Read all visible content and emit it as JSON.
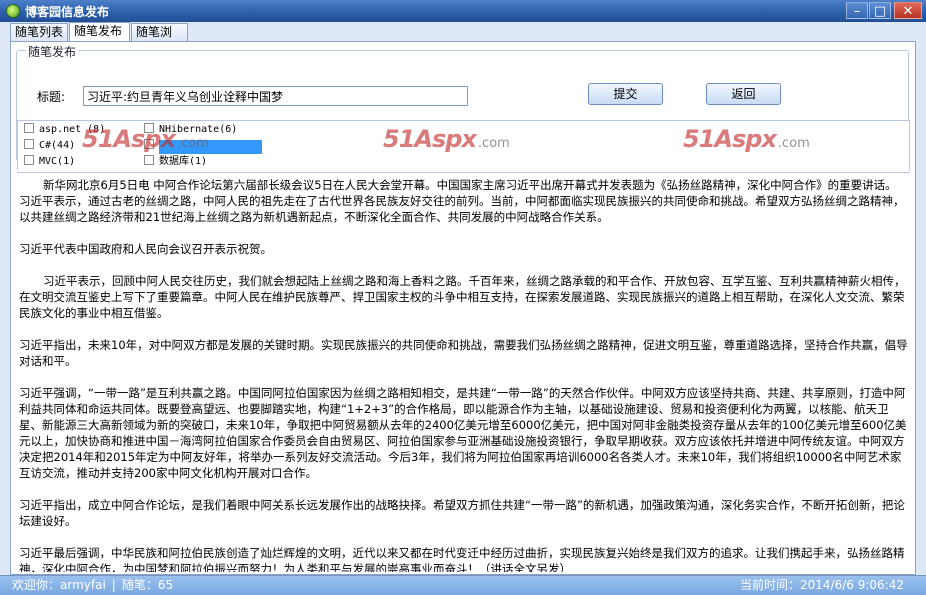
{
  "window": {
    "title": "博客园信息发布",
    "minimize_glyph": "–",
    "maximize_glyph": "□",
    "close_glyph": "✕"
  },
  "tabs": [
    {
      "label": "随笔列表"
    },
    {
      "label": "随笔发布"
    },
    {
      "label": "随笔浏览"
    }
  ],
  "form": {
    "group_title": "随笔发布",
    "title_label": "标题:",
    "title_value": "习近平:约旦青年义乌创业诠释中国梦",
    "submit_label": "提交",
    "back_label": "返回"
  },
  "categories": [
    {
      "label": "asp.net (8)",
      "checked": false
    },
    {
      "label": "NHibernate(6)",
      "checked": false
    },
    {
      "label": "C#(44)",
      "checked": false
    },
    {
      "label": "",
      "checked": false
    },
    {
      "label": "MVC(1)",
      "checked": false
    },
    {
      "label": "数据库(1)",
      "checked": false
    }
  ],
  "watermark": {
    "brand": "51Aspx",
    "suffix": ".com"
  },
  "article": {
    "paragraphs": [
      "新华网北京6月5日电 中阿合作论坛第六届部长级会议5日在人民大会堂开幕。中国国家主席习近平出席开幕式并发表题为《弘扬丝路精神，深化中阿合作》的重要讲话。习近平表示，通过古老的丝绸之路，中阿人民的祖先走在了古代世界各民族友好交往的前列。当前，中阿都面临实现民族振兴的共同使命和挑战。希望双方弘扬丝绸之路精神，以共建丝绸之路经济带和21世纪海上丝绸之路为新机遇新起点，不断深化全面合作、共同发展的中阿战略合作关系。",
      "习近平代表中国政府和人民向会议召开表示祝贺。",
      "习近平表示，回顾中阿人民交往历史，我们就会想起陆上丝绸之路和海上香料之路。千百年来，丝绸之路承载的和平合作、开放包容、互学互鉴、互利共赢精神薪火相传，在文明交流互鉴史上写下了重要篇章。中阿人民在维护民族尊严、捍卫国家主权的斗争中相互支持，在探索发展道路、实现民族振兴的道路上相互帮助，在深化人文交流、繁荣民族文化的事业中相互借鉴。",
      "习近平指出，未来10年，对中阿双方都是发展的关键时期。实现民族振兴的共同使命和挑战，需要我们弘扬丝绸之路精神，促进文明互鉴，尊重道路选择，坚持合作共赢，倡导对话和平。",
      "习近平强调，“一带一路”是互利共赢之路。中国同阿拉伯国家因为丝绸之路相知相交，是共建“一带一路”的天然合作伙伴。中阿双方应该坚持共商、共建、共享原则，打造中阿利益共同体和命运共同体。既要登高望远、也要脚踏实地，构建“1+2+3”的合作格局，即以能源合作为主轴，以基础设施建设、贸易和投资便利化为两翼，以核能、航天卫星、新能源三大高新领域为新的突破口，未来10年，争取把中阿贸易额从去年的2400亿美元增至6000亿美元，把中国对阿非金融类投资存量从去年的100亿美元增至600亿美元以上，加快协商和推进中国－海湾阿拉伯国家合作委员会自由贸易区、阿拉伯国家参与亚洲基础设施投资银行，争取早期收获。双方应该依托并增进中阿传统友谊。中阿双方决定把2014年和2015年定为中阿友好年，将举办一系列友好交流活动。今后3年，我们将为阿拉伯国家再培训6000名各类人才。未来10年，我们将组织10000名中阿艺术家互访交流，推动并支持200家中阿文化机构开展对口合作。",
      "习近平指出，成立中阿合作论坛，是我们着眼中阿关系长远发展作出的战略抉择。希望双方抓住共建“一带一路”的新机遇，加强政策沟通，深化务实合作，不断开拓创新，把论坛建设好。",
      "习近平最后强调，中华民族和阿拉伯民族创造了灿烂辉煌的文明，近代以来又都在时代变迁中经历过曲折，实现民族复兴始终是我们双方的追求。让我们携起手来，弘扬丝路精神，深化中阿合作，为中国梦和阿拉伯振兴而努力！为人类和平与发展的崇高事业而奋斗！（讲话全文另发）"
    ]
  },
  "status": {
    "welcome": "欢迎你：armyfai",
    "separator": "|",
    "count_text": "随笔：65",
    "time_text": "当前时间：2014/6/6 9:06:42"
  }
}
